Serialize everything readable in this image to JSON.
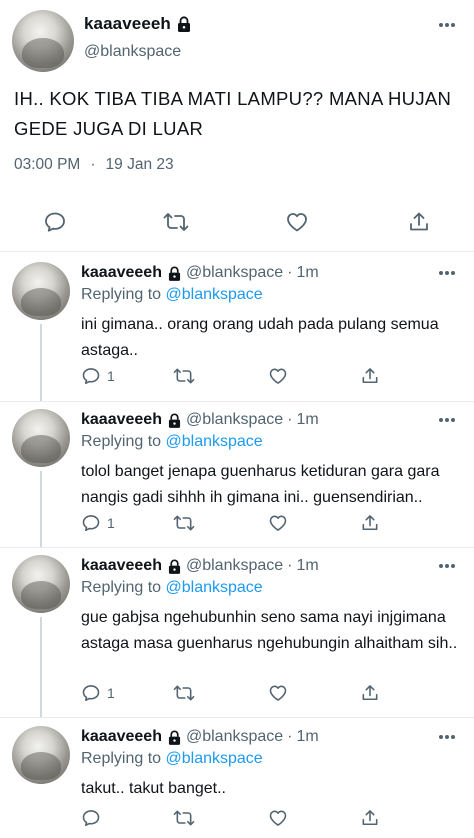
{
  "main_tweet": {
    "name": "kaaaveeeh",
    "handle": "@blankspace",
    "text": "IH.. KOK TIBA TIBA MATI LAMPU?? MANA HUJAN GEDE JUGA DI LUAR",
    "time": "03:00 PM",
    "separator": "·",
    "date": "19 Jan 23"
  },
  "replies": [
    {
      "name": "kaaaveeeh",
      "handle": "@blankspace",
      "separator": "·",
      "age": "1m",
      "replying_prefix": "Replying to",
      "replying_to": "@blankspace",
      "text": "ini gimana.. orang orang udah pada pulang semua astaga..",
      "reply_count": "1"
    },
    {
      "name": "kaaaveeeh",
      "handle": "@blankspace",
      "separator": "·",
      "age": "1m",
      "replying_prefix": "Replying to",
      "replying_to": "@blankspace",
      "text": "tolol banget jenapa guenharus ketiduran gara gara nangis gadi sihhh ih gimana ini.. guensendirian..",
      "reply_count": "1"
    },
    {
      "name": "kaaaveeeh",
      "handle": "@blankspace",
      "separator": "·",
      "age": "1m",
      "replying_prefix": "Replying to",
      "replying_to": "@blankspace",
      "text": "gue gabjsa ngehubunhin seno sama nayi injgimana astaga masa guenharus ngehubungin alhaitham sih..",
      "reply_count": "1"
    },
    {
      "name": "kaaaveeeh",
      "handle": "@blankspace",
      "separator": "·",
      "age": "1m",
      "replying_prefix": "Replying to",
      "replying_to": "@blankspace",
      "text": "takut.. takut banget..",
      "reply_count": ""
    }
  ],
  "colors": {
    "text": "#0f1419",
    "secondary": "#536471",
    "link": "#1d9bf0",
    "divider": "#e6ecf0"
  },
  "icons": [
    "lock-icon",
    "more-icon",
    "reply-icon",
    "retweet-icon",
    "like-icon",
    "share-icon"
  ]
}
